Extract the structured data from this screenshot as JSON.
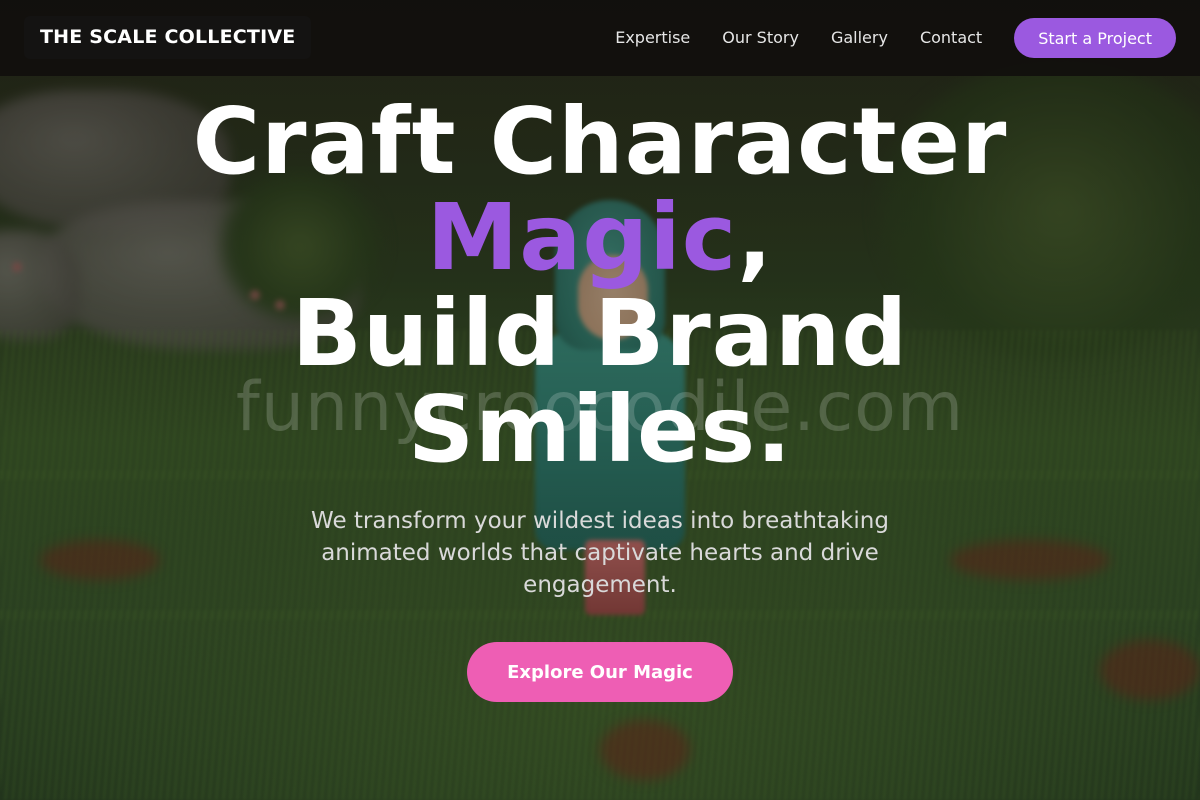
{
  "brand": {
    "name": "THE SCALE COLLECTIVE"
  },
  "nav": {
    "links": [
      "Expertise",
      "Our Story",
      "Gallery",
      "Contact"
    ],
    "cta_label": "Start a Project"
  },
  "hero": {
    "title_line1": "Craft Character",
    "title_accent": "Magic",
    "title_comma": ",",
    "title_line3": "Build Brand",
    "title_line4": "Smiles.",
    "subtitle": "We transform your wildest ideas into breathtaking animated worlds that captivate hearts and drive engagement.",
    "cta_label": "Explore Our Magic"
  },
  "watermark": "funnycroocodile.com",
  "colors": {
    "accent_purple": "#9b59e0",
    "accent_pink": "#ee5eb4",
    "header_bg": "#100e0c"
  }
}
